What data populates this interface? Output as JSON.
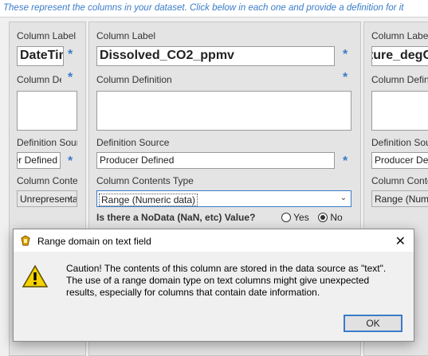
{
  "banner": {
    "text": "These represent the columns in your dataset. Click below in each one and provide a definition for it"
  },
  "columns": [
    {
      "label_caption": "Column Label",
      "label_value": "DateTime",
      "definition_caption": "Column Definition",
      "definition_value": "",
      "source_caption": "Definition Source",
      "source_value": "Producer Defined",
      "type_caption": "Column Contents Type",
      "type_value": "Unrepresentable"
    },
    {
      "label_caption": "Column Label",
      "label_value": "Dissolved_CO2_ppmv",
      "definition_caption": "Column Definition",
      "definition_value": "",
      "source_caption": "Definition Source",
      "source_value": "Producer Defined",
      "type_caption": "Column Contents Type",
      "type_value": "Range (Numeric data)",
      "nodata_question": "Is there a NoData (NaN, etc) Value?",
      "nodata_yes": "Yes",
      "nodata_no": "No",
      "nodata_selected": "No"
    },
    {
      "label_caption": "Column Label",
      "label_value": "Temperature_degC",
      "definition_caption": "Column Definition",
      "definition_value": "",
      "source_caption": "Definition Source",
      "source_value": "Producer Defined",
      "type_caption": "Column Contents Type",
      "type_value": "Range (Numeric data)"
    }
  ],
  "required_marker": "*",
  "dialog": {
    "title": "Range domain on text field",
    "message": "Caution! The contents of this column are stored in the data source as \"text\".  The use of a range domain type on text columns might give unexpected results, especially for columns that contain date information.",
    "ok_label": "OK",
    "close_label": "✕"
  },
  "colors": {
    "accent": "#3a7bc8",
    "warning": "#f5d200"
  }
}
